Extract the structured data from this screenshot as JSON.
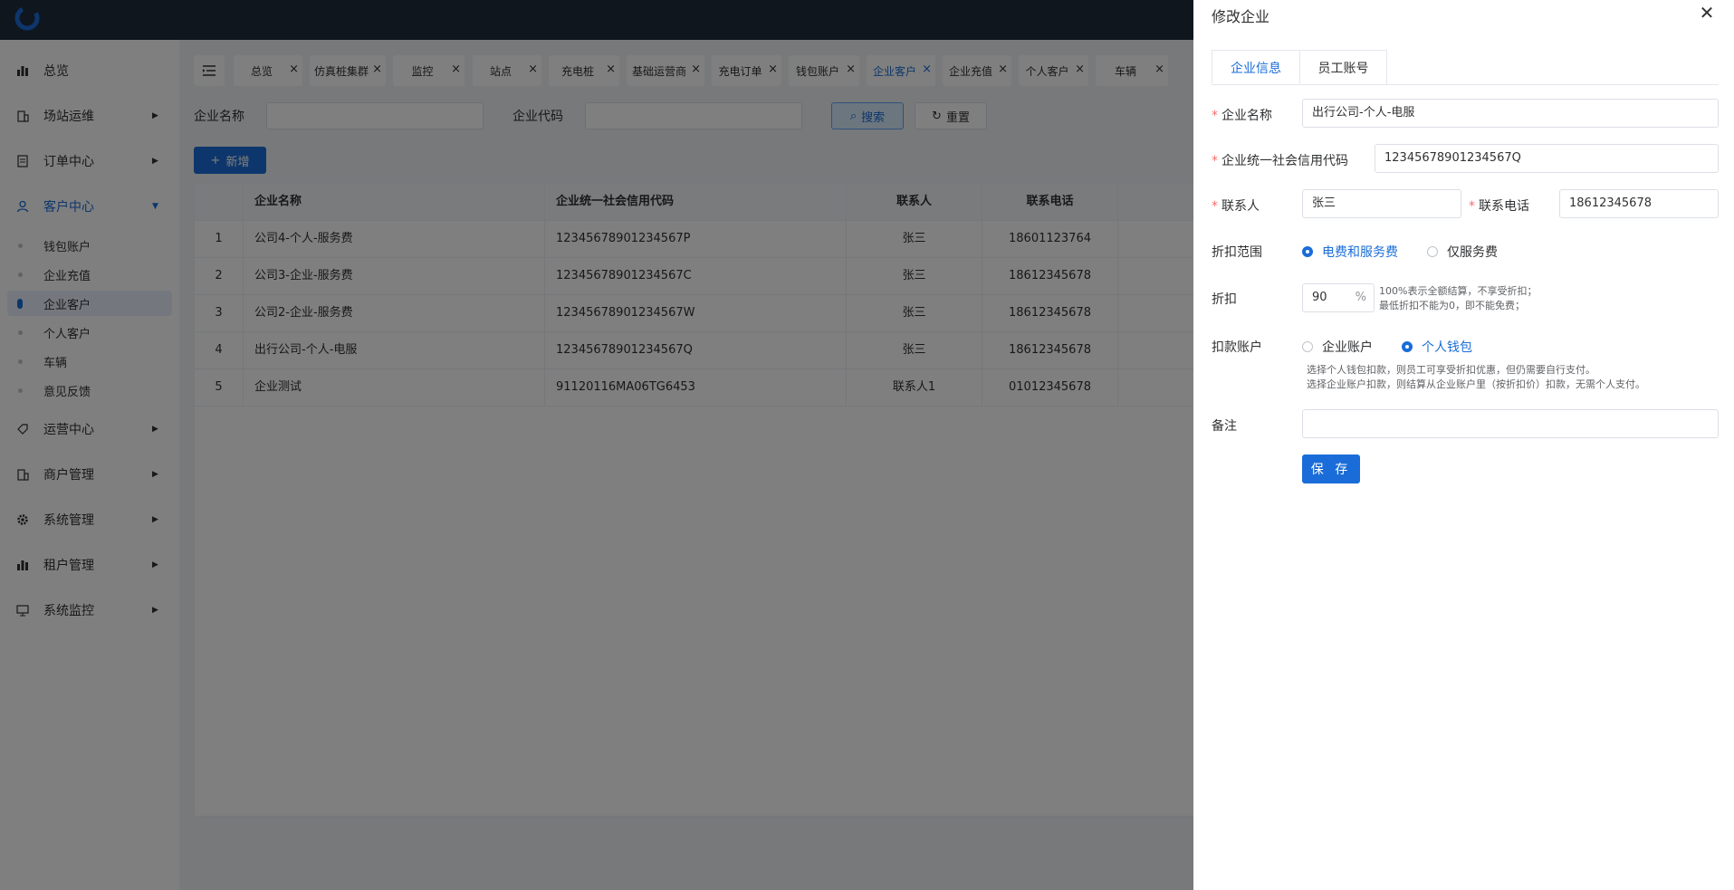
{
  "sidebar": {
    "items": [
      {
        "label": "总览",
        "icon": "bar-chart-icon"
      },
      {
        "label": "场站运维",
        "icon": "building-icon"
      },
      {
        "label": "订单中心",
        "icon": "document-icon"
      },
      {
        "label": "客户中心",
        "icon": "user-icon"
      },
      {
        "label": "运营中心",
        "icon": "tag-icon"
      },
      {
        "label": "商户管理",
        "icon": "building-icon"
      },
      {
        "label": "系统管理",
        "icon": "gear-icon"
      },
      {
        "label": "租户管理",
        "icon": "bar-chart-icon"
      },
      {
        "label": "系统监控",
        "icon": "monitor-icon"
      }
    ],
    "sub_items": [
      "钱包账户",
      "企业充值",
      "企业客户",
      "个人客户",
      "车辆",
      "意见反馈"
    ]
  },
  "tabs": [
    "总览",
    "仿真桩集群",
    "监控",
    "站点",
    "充电桩",
    "基础运营商",
    "充电订单",
    "钱包账户",
    "企业客户",
    "企业充值",
    "个人客户",
    "车辆"
  ],
  "search": {
    "name_label": "企业名称",
    "code_label": "企业代码",
    "search_button": "搜索",
    "reset_button": "重置",
    "add_button": "新增"
  },
  "table": {
    "columns": [
      "企业名称",
      "企业统一社会信用代码",
      "联系人",
      "联系电话"
    ],
    "rows": [
      {
        "index": "1",
        "name": "公司4-个人-服务费",
        "code": "12345678901234567P",
        "contact": "张三",
        "phone": "18601123764"
      },
      {
        "index": "2",
        "name": "公司3-企业-服务费",
        "code": "12345678901234567C",
        "contact": "张三",
        "phone": "18612345678"
      },
      {
        "index": "3",
        "name": "公司2-企业-服务费",
        "code": "12345678901234567W",
        "contact": "张三",
        "phone": "18612345678"
      },
      {
        "index": "4",
        "name": "出行公司-个人-电服",
        "code": "12345678901234567Q",
        "contact": "张三",
        "phone": "18612345678"
      },
      {
        "index": "5",
        "name": "企业测试",
        "code": "91120116MA06TG6453",
        "contact": "联系人1",
        "phone": "01012345678"
      }
    ]
  },
  "drawer": {
    "title": "修改企业",
    "tabs": [
      "企业信息",
      "员工账号"
    ],
    "fields": {
      "name_label": "企业名称",
      "name_value": "出行公司-个人-电服",
      "code_label": "企业统一社会信用代码",
      "code_value": "12345678901234567Q",
      "contact_label": "联系人",
      "contact_value": "张三",
      "phone_label": "联系电话",
      "phone_value": "18612345678",
      "scope_label": "折扣范围",
      "scope_options": [
        "电费和服务费",
        "仅服务费"
      ],
      "scope_selected": "电费和服务费",
      "discount_label": "折扣",
      "discount_value": "90",
      "discount_unit": "%",
      "discount_hint_1": "100%表示全额结算，不享受折扣；",
      "discount_hint_2": "最低折扣不能为0，即不能免费；",
      "account_label": "扣款账户",
      "account_options": [
        "企业账户",
        "个人钱包"
      ],
      "account_selected": "个人钱包",
      "account_hint_1": "选择个人钱包扣款，则员工可享受折扣优惠，但仍需要自行支付。",
      "account_hint_2": "选择企业账户扣款，则结算从企业账户里（按折扣价）扣款，无需个人支付。",
      "remark_label": "备注",
      "remark_value": ""
    },
    "save_button": "保 存"
  },
  "colors": {
    "primary": "#1a6dd8",
    "topbar": "#1f2d3d",
    "required": "#f56c6c"
  }
}
